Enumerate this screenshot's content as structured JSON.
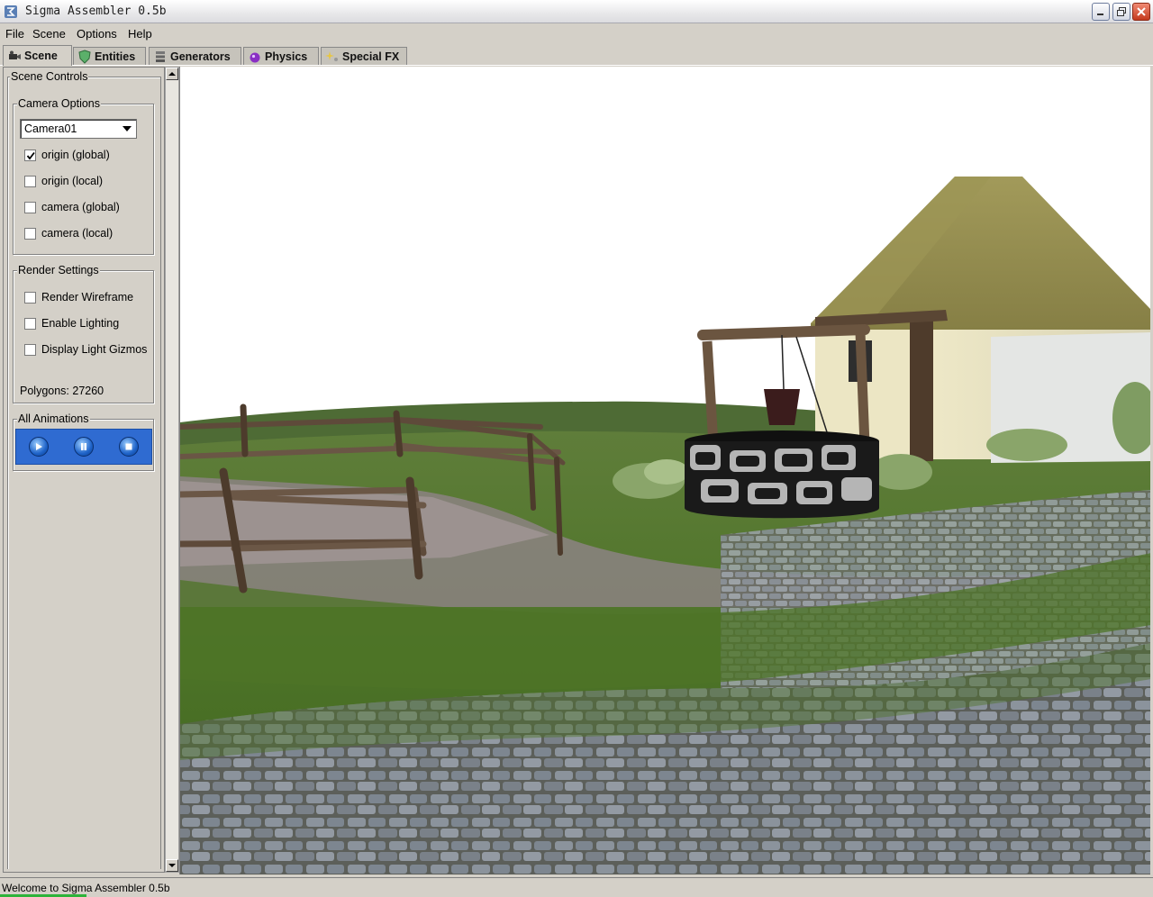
{
  "window": {
    "title": "Sigma Assembler 0.5b",
    "app_icon": "sigma-app-icon",
    "controls": {
      "minimize_icon": "minimize-icon",
      "restore_icon": "restore-icon",
      "close_icon": "close-icon"
    }
  },
  "menu": {
    "items": [
      "File",
      "Scene",
      "Options",
      "Help"
    ]
  },
  "tabs": [
    {
      "label": "Scene",
      "icon": "camera-icon",
      "active": true
    },
    {
      "label": "Entities",
      "icon": "shield-icon",
      "active": false
    },
    {
      "label": "Generators",
      "icon": "stack-icon",
      "active": false
    },
    {
      "label": "Physics",
      "icon": "physics-ball-icon",
      "active": false
    },
    {
      "label": "Special FX",
      "icon": "sparkle-icon",
      "active": false
    }
  ],
  "scene_controls": {
    "title": "Scene Controls",
    "camera_options": {
      "title": "Camera Options",
      "selected_camera": "Camera01",
      "checkboxes": [
        {
          "label": "origin (global)",
          "checked": true
        },
        {
          "label": "origin (local)",
          "checked": false
        },
        {
          "label": "camera (global)",
          "checked": false
        },
        {
          "label": "camera (local)",
          "checked": false
        }
      ]
    },
    "render_settings": {
      "title": "Render Settings",
      "checkboxes": [
        {
          "label": "Render Wireframe",
          "checked": false
        },
        {
          "label": "Enable Lighting",
          "checked": false
        },
        {
          "label": "Display Light Gizmos",
          "checked": false
        }
      ],
      "polygons_label": "Polygons: 27260"
    },
    "animations": {
      "title": "All Animations",
      "buttons": [
        "play-icon",
        "pause-icon",
        "stop-icon"
      ]
    }
  },
  "viewport": {
    "scene": "3D village scene with stone well, fence, thatched house and cobblestone ground"
  },
  "status": {
    "message": "Welcome to Sigma Assembler 0.5b"
  },
  "colors": {
    "window_bg": "#d4d0c8",
    "anim_bar": "#2f6bd1",
    "progress": "#2db33a",
    "sky": "#ffffff",
    "grass": "#4f7a2c",
    "cobble": "#7d848c"
  }
}
